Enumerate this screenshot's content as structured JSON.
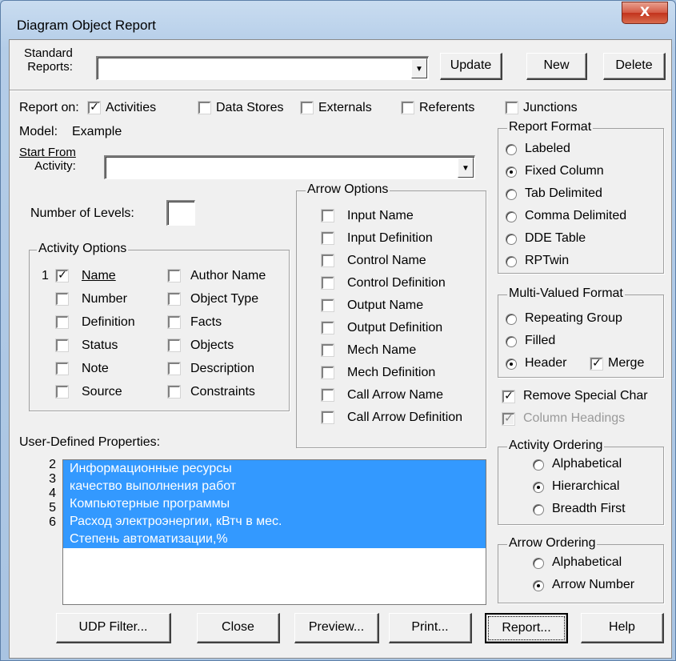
{
  "window": {
    "title": "Diagram Object Report",
    "close_label": "X"
  },
  "standard_reports": {
    "label_line1": "Standard",
    "label_line2": "Reports:",
    "value": ""
  },
  "top_buttons": {
    "update": "Update",
    "new": "New",
    "delete": "Delete"
  },
  "report_on": {
    "label": "Report on:",
    "items": [
      {
        "label": "Activities",
        "checked": true
      },
      {
        "label": "Data Stores",
        "checked": false
      },
      {
        "label": "Externals",
        "checked": false
      },
      {
        "label": "Referents",
        "checked": false
      },
      {
        "label": "Junctions",
        "checked": false
      }
    ]
  },
  "model": {
    "label": "Model:",
    "value": "Example"
  },
  "start_from": {
    "label_line1": "Start From",
    "label_line2": "Activity:",
    "value": ""
  },
  "number_of_levels": {
    "label": "Number of Levels:",
    "value": ""
  },
  "activity_options": {
    "title": "Activity Options",
    "name_order": "1",
    "left": [
      {
        "label": "Name",
        "checked": true
      },
      {
        "label": "Number",
        "checked": false
      },
      {
        "label": "Definition",
        "checked": false
      },
      {
        "label": "Status",
        "checked": false
      },
      {
        "label": "Note",
        "checked": false
      },
      {
        "label": "Source",
        "checked": false
      }
    ],
    "right": [
      {
        "label": "Author Name",
        "checked": false
      },
      {
        "label": "Object Type",
        "checked": false
      },
      {
        "label": "Facts",
        "checked": false
      },
      {
        "label": "Objects",
        "checked": false
      },
      {
        "label": "Description",
        "checked": false
      },
      {
        "label": "Constraints",
        "checked": false
      }
    ]
  },
  "arrow_options": {
    "title": "Arrow Options",
    "items": [
      {
        "label": "Input Name",
        "checked": false
      },
      {
        "label": "Input Definition",
        "checked": false
      },
      {
        "label": "Control Name",
        "checked": false
      },
      {
        "label": "Control Definition",
        "checked": false
      },
      {
        "label": "Output Name",
        "checked": false
      },
      {
        "label": "Output Definition",
        "checked": false
      },
      {
        "label": "Mech Name",
        "checked": false
      },
      {
        "label": "Mech Definition",
        "checked": false
      },
      {
        "label": "Call Arrow Name",
        "checked": false
      },
      {
        "label": "Call Arrow Definition",
        "checked": false
      }
    ]
  },
  "report_format": {
    "title": "Report Format",
    "options": [
      "Labeled",
      "Fixed Column",
      "Tab Delimited",
      "Comma Delimited",
      "DDE Table",
      "RPTwin"
    ],
    "selected": "Fixed Column"
  },
  "multi_valued_format": {
    "title": "Multi-Valued Format",
    "options": [
      "Repeating Group",
      "Filled",
      "Header"
    ],
    "selected": "Header",
    "merge_label": "Merge",
    "merge_checked": true
  },
  "remove_special_char": {
    "label": "Remove Special Char",
    "checked": true
  },
  "column_headings": {
    "label": "Column Headings",
    "checked": true,
    "disabled": true
  },
  "activity_ordering": {
    "title": "Activity Ordering",
    "options": [
      "Alphabetical",
      "Hierarchical",
      "Breadth First"
    ],
    "selected": "Hierarchical"
  },
  "arrow_ordering": {
    "title": "Arrow Ordering",
    "options": [
      "Alphabetical",
      "Arrow Number"
    ],
    "selected": "Arrow Number"
  },
  "udp": {
    "label": "User-Defined Properties:",
    "items": [
      {
        "num": "2",
        "text": "Информационные ресурсы",
        "selected": true
      },
      {
        "num": "3",
        "text": "качество выполнения работ",
        "selected": true
      },
      {
        "num": "4",
        "text": "Компьютерные программы",
        "selected": true
      },
      {
        "num": "5",
        "text": "Расход электроэнергии, кВтч в мес.",
        "selected": true
      },
      {
        "num": "6",
        "text": "Степень автоматизации,%",
        "selected": true
      }
    ]
  },
  "bottom_buttons": {
    "udp_filter": "UDP Filter...",
    "close": "Close",
    "preview": "Preview...",
    "print": "Print...",
    "report": "Report...",
    "help": "Help"
  },
  "colors": {
    "selection": "#3399ff",
    "dialog_bg": "#f0f0f0",
    "close_button": "#c2331c"
  }
}
